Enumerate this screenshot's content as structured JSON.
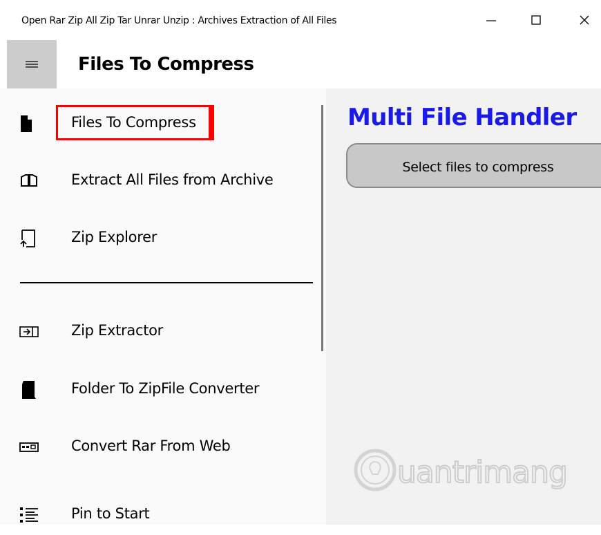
{
  "window": {
    "title": "Open Rar Zip All Zip Tar Unrar Unzip : Archives Extraction of All Files",
    "controls": [
      "minimize-icon",
      "maximize-icon",
      "close-icon"
    ]
  },
  "header": {
    "menu_icon": "hamburger-icon",
    "title": "Files To Compress"
  },
  "nav": {
    "items": [
      {
        "label": "Files To Compress",
        "icon": "document-icon",
        "selected": true
      },
      {
        "label": "Extract All Files from  Archive",
        "icon": "open-book-icon"
      },
      {
        "label": "Zip Explorer",
        "icon": "folder-explorer-icon"
      },
      {
        "label": "Zip Extractor",
        "icon": "extract-icon"
      },
      {
        "label": "Folder To ZipFile Converter",
        "icon": "folder-zip-icon"
      },
      {
        "label": "Convert Rar From Web",
        "icon": "web-convert-icon"
      },
      {
        "label": "Pin to Start",
        "icon": "list-pin-icon"
      }
    ]
  },
  "main": {
    "title": "Multi File Handler",
    "select_button": "Select files to compress"
  },
  "watermark": {
    "text": "Quantrimang"
  },
  "colors": {
    "accent_title": "#1a1ae6",
    "selection_border": "#ff0000",
    "hamburger_bg": "#cccccc",
    "button_bg": "#c8c8c8"
  }
}
